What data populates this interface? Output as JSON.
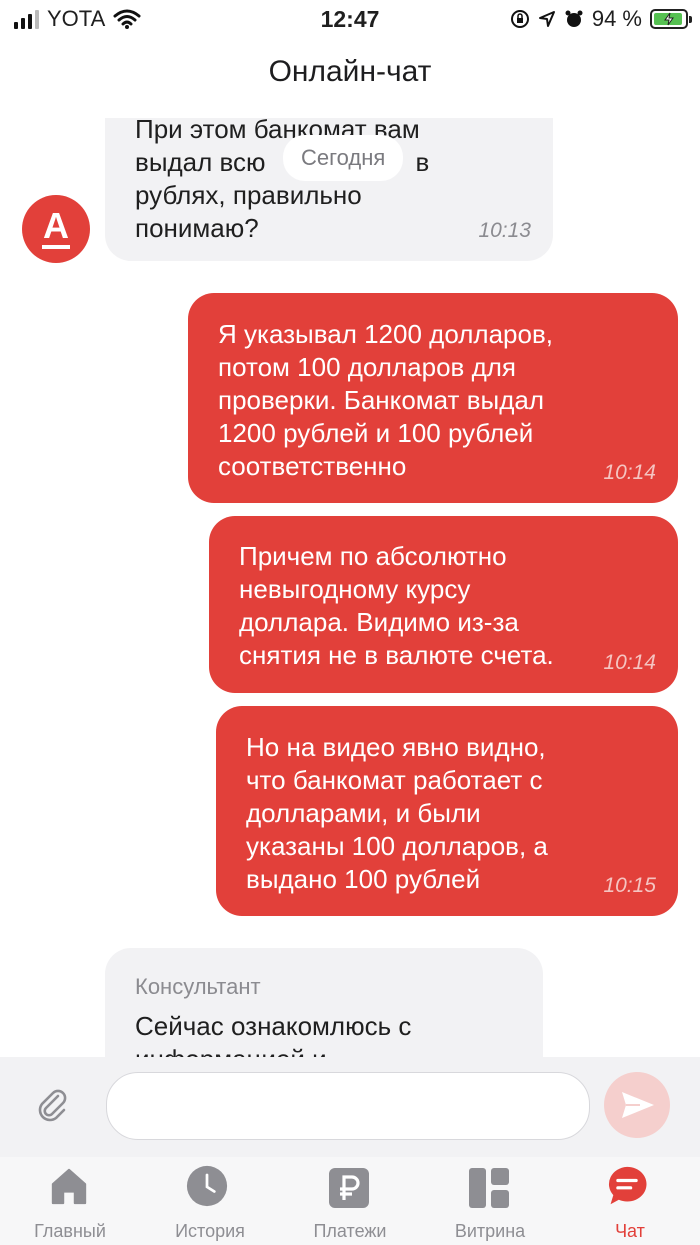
{
  "status_bar": {
    "carrier": "YOTA",
    "time": "12:47",
    "battery": "94 %"
  },
  "header": {
    "title": "Онлайн-чат"
  },
  "chat": {
    "date_chip": "Сегодня",
    "avatar_letter": "А",
    "incoming_top": {
      "lines": [
        "При этом банкомат вам",
        "выдал всю",
        "рублях, правильно",
        "понимаю?"
      ],
      "line2_tail": "в",
      "time": "10:13"
    },
    "outgoing": [
      {
        "lines": [
          "Я указывал 1200 долларов,",
          "потом 100 долларов для",
          "проверки. Банкомат выдал",
          "1200 рублей и 100 рублей",
          "соответственно"
        ],
        "time": "10:14"
      },
      {
        "lines": [
          "Причем по абсолютно",
          "невыгодному курсу",
          "доллара. Видимо из-за",
          "снятия не в валюте счета."
        ],
        "time": "10:14"
      },
      {
        "lines": [
          "Но на видео явно видно,",
          "что банкомат работает с",
          "долларами, и были",
          "указаны 100 долларов, а",
          "выдано 100 рублей"
        ],
        "time": "10:15"
      }
    ],
    "incoming_bottom": {
      "sender": "Консультант",
      "lines": [
        "Сейчас ознакомлюсь с",
        "информацией и"
      ]
    }
  },
  "compose": {
    "placeholder": ""
  },
  "tabs": [
    {
      "label": "Главный",
      "icon": "home-icon"
    },
    {
      "label": "История",
      "icon": "clock-icon"
    },
    {
      "label": "Платежи",
      "icon": "ruble-icon"
    },
    {
      "label": "Витрина",
      "icon": "grid-icon"
    },
    {
      "label": "Чат",
      "icon": "chat-icon",
      "active": true
    }
  ],
  "colors": {
    "accent": "#e2403a",
    "incoming_bg": "#f2f2f4",
    "send_disabled": "#f5cfcd"
  }
}
